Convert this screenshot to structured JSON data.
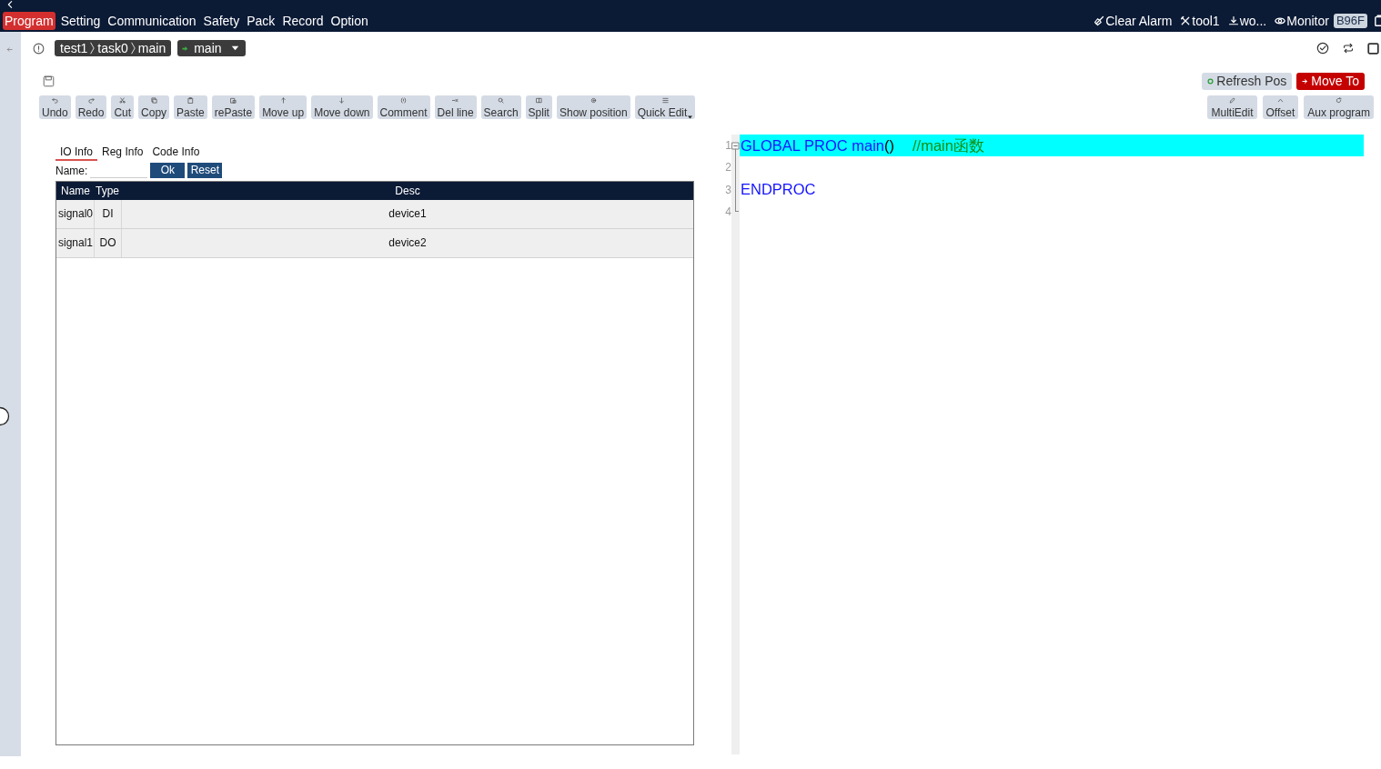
{
  "top_bar": {
    "menu": [
      {
        "label": "Program",
        "selected": true
      },
      {
        "label": "Setting",
        "selected": false
      },
      {
        "label": "Communication",
        "selected": false
      },
      {
        "label": "Safety",
        "selected": false
      },
      {
        "label": "Pack",
        "selected": false
      },
      {
        "label": "Record",
        "selected": false
      },
      {
        "label": "Option",
        "selected": false
      }
    ],
    "actions": [
      "Clear Alarm",
      "tool1",
      "wo...",
      "Monitor"
    ],
    "badge": "B96F"
  },
  "location": {
    "breadcrumb": [
      "test1",
      "task0",
      "main"
    ],
    "procedure": "main"
  },
  "quick_actions": [
    {
      "label": "Refresh Pos",
      "kind": "normal"
    },
    {
      "label": "Move To",
      "kind": "alert"
    }
  ],
  "toolbar": [
    {
      "label": "Undo",
      "kind": "button"
    },
    {
      "label": "Redo",
      "kind": "button"
    },
    {
      "label": "Cut",
      "kind": "button"
    },
    {
      "label": "Copy",
      "kind": "button"
    },
    {
      "label": "Paste",
      "kind": "button"
    },
    {
      "label": "rePaste",
      "kind": "button"
    },
    {
      "label": "Move up",
      "kind": "button"
    },
    {
      "label": "Move down",
      "kind": "button"
    },
    {
      "label": "Comment",
      "kind": "button"
    },
    {
      "label": "Del line",
      "kind": "button"
    },
    {
      "label": "Search",
      "kind": "button"
    },
    {
      "label": "Split",
      "kind": "button"
    },
    {
      "label": "Show position",
      "kind": "button"
    },
    {
      "label": "Quick Edit",
      "kind": "dropdown"
    }
  ],
  "side_toolbar": [
    "MultiEdit",
    "Offset",
    "Aux program"
  ],
  "info_panel": {
    "tabs": [
      {
        "label": "IO Info",
        "selected": true
      },
      {
        "label": "Reg Info",
        "selected": false
      },
      {
        "label": "Code Info",
        "selected": false
      }
    ],
    "filter": {
      "label": "Name:",
      "buttons": [
        "Ok",
        "Reset"
      ]
    },
    "table": {
      "columns": [
        "Name",
        "Type",
        "Desc"
      ],
      "rows": [
        [
          "signal0",
          "DI",
          "device1"
        ],
        [
          "signal1",
          "DO",
          "device2"
        ]
      ]
    }
  },
  "editor": {
    "lines": [
      {
        "number": "1",
        "highlighted": true,
        "kind": "foldstart",
        "tokens": [
          {
            "text": "GLOBAL PROC main",
            "kind": "keyword"
          },
          {
            "text": "()",
            "kind": "plain"
          },
          {
            "text": "//main函数",
            "kind": "comment"
          }
        ]
      },
      {
        "number": "2",
        "highlighted": false,
        "kind": "body"
      },
      {
        "number": "3",
        "highlighted": false,
        "kind": "body",
        "tokens": [
          {
            "text": "ENDPROC",
            "kind": "keyword"
          }
        ]
      },
      {
        "number": "4",
        "highlighted": false,
        "kind": "foldend"
      }
    ]
  }
}
